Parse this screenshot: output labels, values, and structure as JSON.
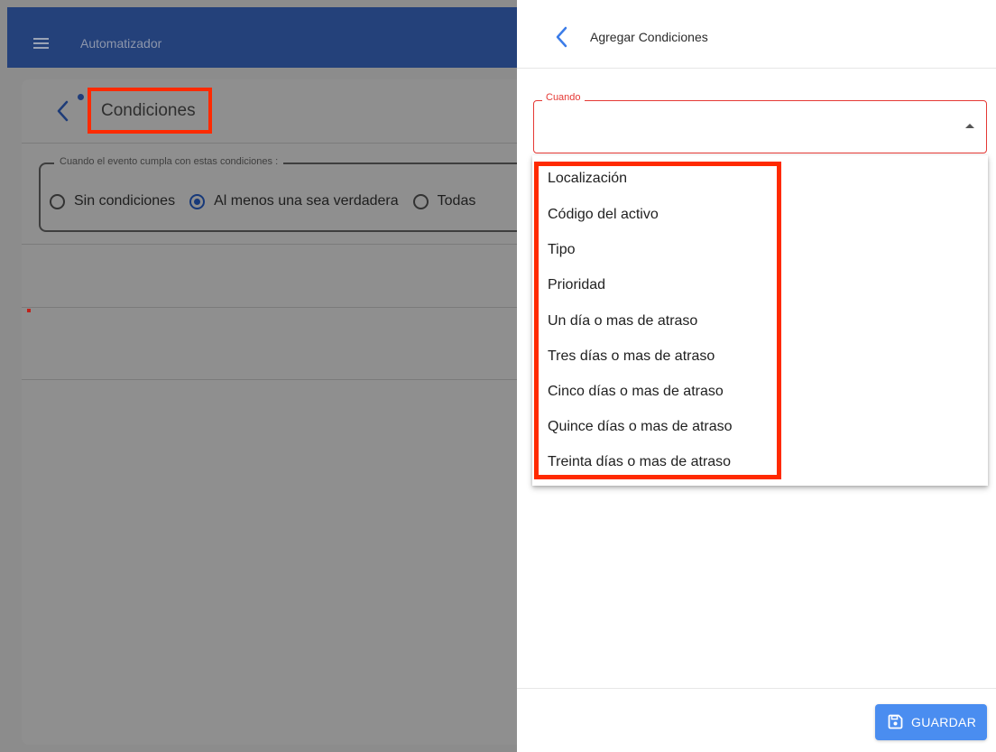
{
  "app": {
    "title": "Automatizador",
    "menu_icon": "hamburger-menu-icon"
  },
  "card": {
    "back_icon": "chevron-left-icon",
    "title": "Condiciones",
    "conditions_legend": "Cuando el evento cumpla con estas condiciones :",
    "options": [
      {
        "label": "Sin condiciones",
        "selected": false
      },
      {
        "label": "Al menos una sea verdadera",
        "selected": true
      },
      {
        "label": "Todas",
        "selected": false
      }
    ]
  },
  "panel": {
    "title": "Agregar Condiciones",
    "back_icon": "chevron-left-icon",
    "select": {
      "label": "Cuando",
      "value": "",
      "open": true,
      "options": [
        "Localización",
        "Código del activo",
        "Tipo",
        "Prioridad",
        "Un día o mas de atraso",
        "Tres días o mas de atraso",
        "Cinco días o mas de atraso",
        "Quince días o mas de atraso",
        "Treinta días o mas de atraso"
      ]
    },
    "save_button": {
      "label": "GUARDAR",
      "icon": "floppy-disk-icon"
    }
  },
  "colors": {
    "topbar": "#24417a",
    "accent": "#4a8df0",
    "error": "#e53935",
    "highlight": "#ff2a00"
  }
}
